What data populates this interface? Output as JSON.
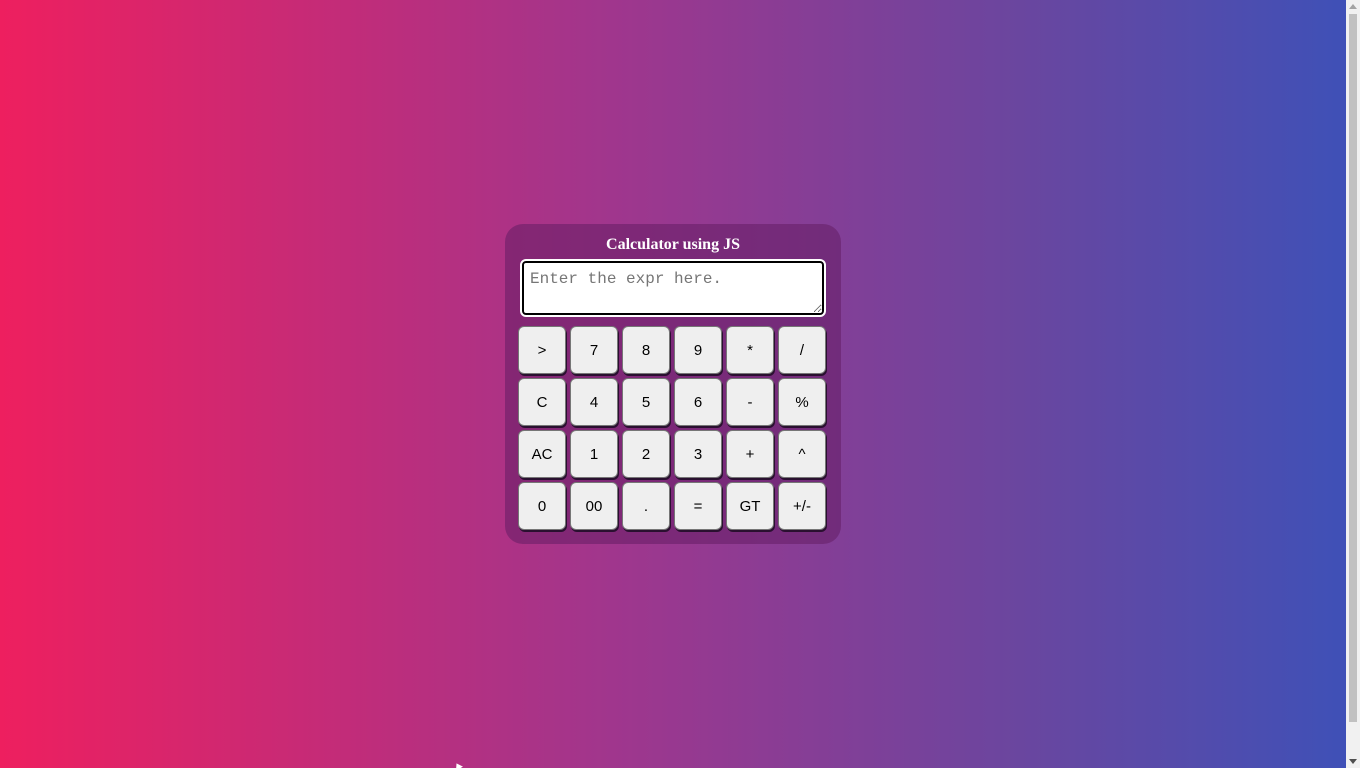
{
  "calculator": {
    "title": "Calculator using JS",
    "expression": {
      "value": "",
      "placeholder": "Enter the expr here."
    },
    "keys": [
      [
        ">",
        "7",
        "8",
        "9",
        "*",
        "/"
      ],
      [
        "C",
        "4",
        "5",
        "6",
        "-",
        "%"
      ],
      [
        "AC",
        "1",
        "2",
        "3",
        "+",
        "^"
      ],
      [
        "0",
        "00",
        ".",
        "=",
        "GT",
        "+/-"
      ]
    ]
  },
  "colors": {
    "background_left": "#ee1f5f",
    "background_right": "#3d51b8",
    "panel": "#6a2a72",
    "key_face": "#efefef"
  },
  "icons": {
    "cursor": "mouse-pointer-icon"
  }
}
